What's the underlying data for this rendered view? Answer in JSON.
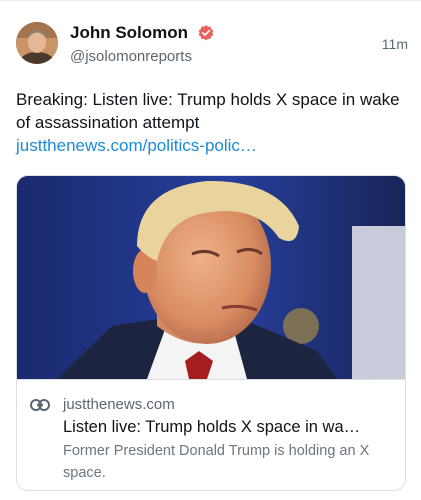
{
  "post": {
    "author": {
      "display_name": "John Solomon",
      "handle": "@jsolomonreports",
      "verified": true,
      "verified_color": "#e8615a"
    },
    "timestamp": "11m",
    "text": "Breaking: Listen live: Trump holds X space in wake of assassination attempt",
    "link_text": "justthenews.com/politics-polic…",
    "link_color": "#1d8bd6"
  },
  "card": {
    "image_icon": "portrait-photo",
    "link_icon": "link-icon",
    "domain": "justthenews.com",
    "title": "Listen live: Trump holds X space in wa…",
    "description": "Former President Donald Trump is holding an X space."
  }
}
